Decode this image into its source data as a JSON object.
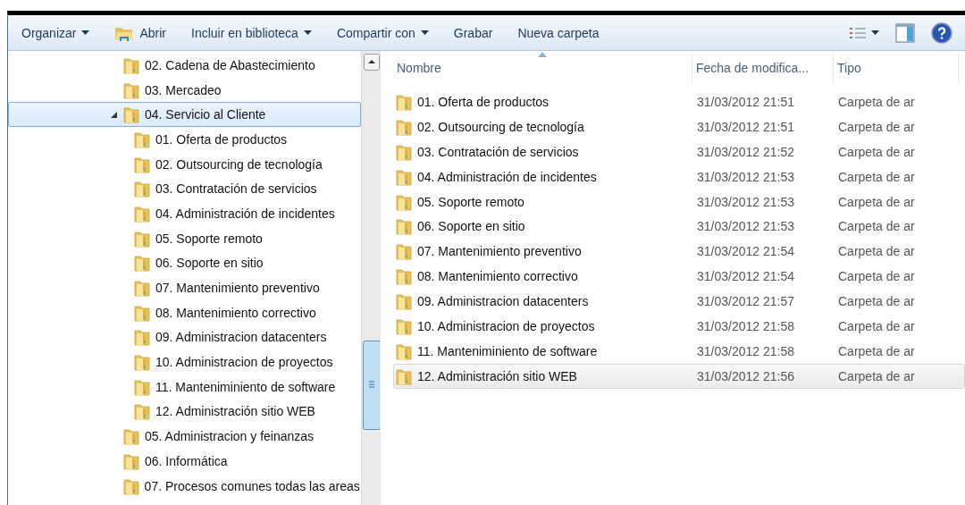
{
  "toolbar": {
    "items": [
      {
        "label": "Organizar",
        "kind": "text",
        "dropdown": true
      },
      {
        "label": "Abrir",
        "kind": "open",
        "dropdown": false
      },
      {
        "label": "Incluir en biblioteca",
        "kind": "text",
        "dropdown": true
      },
      {
        "label": "Compartir con",
        "kind": "text",
        "dropdown": true
      },
      {
        "label": "Grabar",
        "kind": "text",
        "dropdown": false
      },
      {
        "label": "Nueva carpeta",
        "kind": "text",
        "dropdown": false
      }
    ]
  },
  "tree": {
    "items": [
      {
        "label": "02. Cadena de Abastecimiento",
        "expanded": false,
        "selected": false
      },
      {
        "label": "03. Mercadeo",
        "expanded": false,
        "selected": false
      },
      {
        "label": "04. Servicio al Cliente",
        "expanded": true,
        "selected": true,
        "children": [
          {
            "label": "01. Oferta de productos",
            "expanded": false,
            "selected": false
          },
          {
            "label": "02. Outsourcing de tecnología",
            "expanded": false,
            "selected": false
          },
          {
            "label": "03. Contratación de servicios",
            "expanded": false,
            "selected": false
          },
          {
            "label": "04. Administración de incidentes",
            "expanded": false,
            "selected": false
          },
          {
            "label": "05. Soporte remoto",
            "expanded": false,
            "selected": false
          },
          {
            "label": "06. Soporte en sitio",
            "expanded": false,
            "selected": false
          },
          {
            "label": "07. Mantenimiento preventivo",
            "expanded": false,
            "selected": false
          },
          {
            "label": "08. Mantenimiento correctivo",
            "expanded": false,
            "selected": false
          },
          {
            "label": "09. Administracion datacenters",
            "expanded": false,
            "selected": false
          },
          {
            "label": "10. Administracion de proyectos",
            "expanded": false,
            "selected": false
          },
          {
            "label": "11. Manteniminiento de software",
            "expanded": false,
            "selected": false
          },
          {
            "label": "12. Administración sitio WEB",
            "expanded": false,
            "selected": false
          }
        ]
      },
      {
        "label": "05. Administracion y feinanzas",
        "expanded": false,
        "selected": false
      },
      {
        "label": "06. Informática",
        "expanded": false,
        "selected": false
      },
      {
        "label": "07. Procesos comunes todas las areas",
        "expanded": false,
        "selected": false
      }
    ]
  },
  "table": {
    "columns": [
      {
        "label": "Nombre",
        "sorted": true
      },
      {
        "label": "Fecha de modifica...",
        "sorted": false
      },
      {
        "label": "Tipo",
        "sorted": false
      }
    ],
    "rows": [
      {
        "name": "01. Oferta de productos",
        "date": "31/03/2012 21:51",
        "type": "Carpeta de ar",
        "selected": false
      },
      {
        "name": "02. Outsourcing de tecnología",
        "date": "31/03/2012 21:51",
        "type": "Carpeta de ar",
        "selected": false
      },
      {
        "name": "03. Contratación de servicios",
        "date": "31/03/2012 21:52",
        "type": "Carpeta de ar",
        "selected": false
      },
      {
        "name": "04. Administración de incidentes",
        "date": "31/03/2012 21:53",
        "type": "Carpeta de ar",
        "selected": false
      },
      {
        "name": "05. Soporte remoto",
        "date": "31/03/2012 21:53",
        "type": "Carpeta de ar",
        "selected": false
      },
      {
        "name": "06. Soporte en sitio",
        "date": "31/03/2012 21:53",
        "type": "Carpeta de ar",
        "selected": false
      },
      {
        "name": "07. Mantenimiento preventivo",
        "date": "31/03/2012 21:54",
        "type": "Carpeta de ar",
        "selected": false
      },
      {
        "name": "08. Mantenimiento correctivo",
        "date": "31/03/2012 21:54",
        "type": "Carpeta de ar",
        "selected": false
      },
      {
        "name": "09. Administracion datacenters",
        "date": "31/03/2012 21:57",
        "type": "Carpeta de ar",
        "selected": false
      },
      {
        "name": "10. Administracion de proyectos",
        "date": "31/03/2012 21:58",
        "type": "Carpeta de ar",
        "selected": false
      },
      {
        "name": "11. Manteniminiento de software",
        "date": "31/03/2012 21:58",
        "type": "Carpeta de ar",
        "selected": false
      },
      {
        "name": "12. Administración sitio WEB",
        "date": "31/03/2012 21:56",
        "type": "Carpeta de ar",
        "selected": true
      }
    ]
  }
}
